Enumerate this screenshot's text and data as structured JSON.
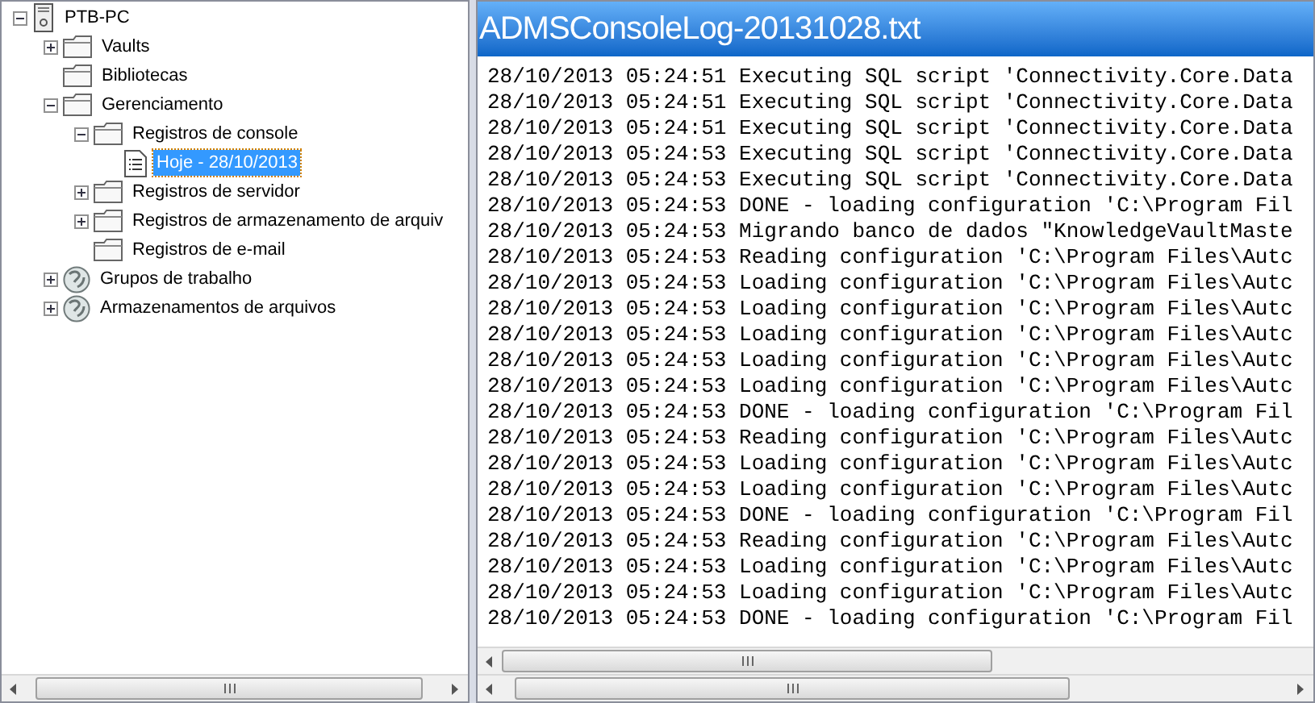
{
  "tree": [
    {
      "label": "PTB-PC",
      "kind": "server",
      "expanded": true,
      "selected": false,
      "children": [
        {
          "label": "Vaults",
          "kind": "folder",
          "expanded": false,
          "selected": false
        },
        {
          "label": "Bibliotecas",
          "kind": "folder",
          "selected": false
        },
        {
          "label": "Gerenciamento",
          "kind": "folder",
          "expanded": true,
          "selected": false,
          "children": [
            {
              "label": "Registros de console",
              "kind": "folder",
              "expanded": true,
              "selected": false,
              "children": [
                {
                  "label": "Hoje - 28/10/2013",
                  "kind": "log",
                  "selected": true
                }
              ]
            },
            {
              "label": "Registros de servidor",
              "kind": "folder",
              "expanded": false,
              "selected": false
            },
            {
              "label": "Registros de armazenamento de arquiv",
              "kind": "folder",
              "expanded": false,
              "selected": false
            },
            {
              "label": "Registros de e-mail",
              "kind": "folder",
              "selected": false
            }
          ]
        },
        {
          "label": "Grupos de trabalho",
          "kind": "globe",
          "expanded": false,
          "selected": false
        },
        {
          "label": "Armazenamentos de arquivos",
          "kind": "globe",
          "expanded": false,
          "selected": false
        }
      ]
    }
  ],
  "log": {
    "title": "ADMSConsoleLog-20131028.txt",
    "lines": [
      "28/10/2013 05:24:51 Executing SQL script 'Connectivity.Core.Data",
      "28/10/2013 05:24:51 Executing SQL script 'Connectivity.Core.Data",
      "28/10/2013 05:24:51 Executing SQL script 'Connectivity.Core.Data",
      "28/10/2013 05:24:53 Executing SQL script 'Connectivity.Core.Data",
      "28/10/2013 05:24:53 Executing SQL script 'Connectivity.Core.Data",
      "28/10/2013 05:24:53 DONE - loading configuration 'C:\\Program Fil",
      "28/10/2013 05:24:53 Migrando banco de dados \"KnowledgeVaultMaste",
      "28/10/2013 05:24:53 Reading configuration 'C:\\Program Files\\Autc",
      "28/10/2013 05:24:53 Loading configuration 'C:\\Program Files\\Autc",
      "28/10/2013 05:24:53 Loading configuration 'C:\\Program Files\\Autc",
      "28/10/2013 05:24:53 Loading configuration 'C:\\Program Files\\Autc",
      "28/10/2013 05:24:53 Loading configuration 'C:\\Program Files\\Autc",
      "28/10/2013 05:24:53 Loading configuration 'C:\\Program Files\\Autc",
      "28/10/2013 05:24:53 DONE - loading configuration 'C:\\Program Fil",
      "28/10/2013 05:24:53 Reading configuration 'C:\\Program Files\\Autc",
      "28/10/2013 05:24:53 Loading configuration 'C:\\Program Files\\Autc",
      "28/10/2013 05:24:53 Loading configuration 'C:\\Program Files\\Autc",
      "28/10/2013 05:24:53 DONE - loading configuration 'C:\\Program Fil",
      "28/10/2013 05:24:53 Reading configuration 'C:\\Program Files\\Autc",
      "28/10/2013 05:24:53 Loading configuration 'C:\\Program Files\\Autc",
      "28/10/2013 05:24:53 Loading configuration 'C:\\Program Files\\Autc",
      "28/10/2013 05:24:53 DONE - loading configuration 'C:\\Program Fil"
    ]
  }
}
